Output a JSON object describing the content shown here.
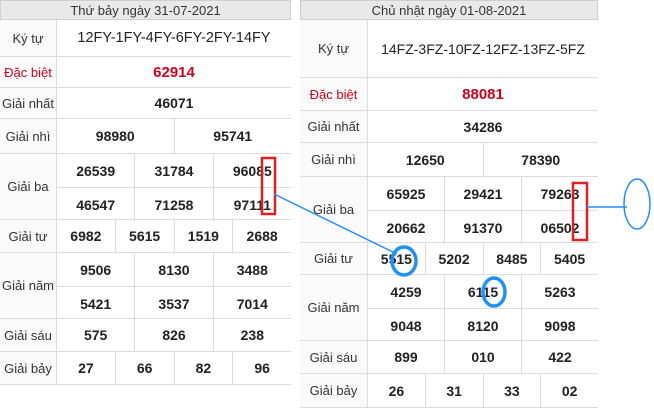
{
  "left": {
    "header": "Thứ bảy ngày 31-07-2021",
    "rows": [
      {
        "label": "Ký tự",
        "lines": [
          [
            "12FY-1FY-4FY-6FY-2FY-14FY"
          ]
        ]
      },
      {
        "label": "Đặc biệt",
        "lines": [
          [
            "62914"
          ]
        ]
      },
      {
        "label": "Giải nhất",
        "lines": [
          [
            "46071"
          ]
        ]
      },
      {
        "label": "Giải nhì",
        "lines": [
          [
            "98980",
            "95741"
          ]
        ]
      },
      {
        "label": "Giải ba",
        "lines": [
          [
            "26539",
            "31784",
            "96085"
          ],
          [
            "46547",
            "71258",
            "97111"
          ]
        ]
      },
      {
        "label": "Giải tư",
        "lines": [
          [
            "6982",
            "5615",
            "1519",
            "2688"
          ]
        ]
      },
      {
        "label": "Giải năm",
        "lines": [
          [
            "9506",
            "8130",
            "3488"
          ],
          [
            "5421",
            "3537",
            "7014"
          ]
        ]
      },
      {
        "label": "Giải sáu",
        "lines": [
          [
            "575",
            "826",
            "238"
          ]
        ]
      },
      {
        "label": "Giải bảy",
        "lines": [
          [
            "27",
            "66",
            "82",
            "96"
          ]
        ]
      }
    ]
  },
  "right": {
    "header": "Chủ nhật ngày 01-08-2021",
    "rows": [
      {
        "label": "Ký tự",
        "lines": [
          [
            "14FZ-3FZ-10FZ-12FZ-13FZ-5FZ"
          ]
        ]
      },
      {
        "label": "Đặc biệt",
        "lines": [
          [
            "88081"
          ]
        ]
      },
      {
        "label": "Giải nhất",
        "lines": [
          [
            "34286"
          ]
        ]
      },
      {
        "label": "Giải nhì",
        "lines": [
          [
            "12650",
            "78390"
          ]
        ]
      },
      {
        "label": "Giải ba",
        "lines": [
          [
            "65925",
            "29421",
            "79263"
          ],
          [
            "20662",
            "91370",
            "06502"
          ]
        ]
      },
      {
        "label": "Giải tư",
        "lines": [
          [
            "5515",
            "5202",
            "8485",
            "5405"
          ]
        ]
      },
      {
        "label": "Giải năm",
        "lines": [
          [
            "4259",
            "6115",
            "5263"
          ],
          [
            "9048",
            "8120",
            "9098"
          ]
        ]
      },
      {
        "label": "Giải sáu",
        "lines": [
          [
            "899",
            "010",
            "422"
          ]
        ]
      },
      {
        "label": "Giải bảy",
        "lines": [
          [
            "26",
            "31",
            "33",
            "02"
          ]
        ]
      }
    ]
  },
  "colors": {
    "special": "#d0021b",
    "annotation_rect": "#e02020",
    "annotation_circle": "#1e90ff"
  }
}
